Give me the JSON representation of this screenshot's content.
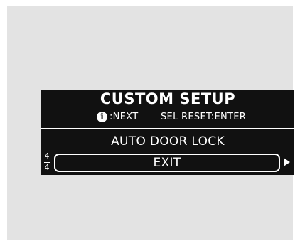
{
  "screen": {
    "title": "CUSTOM SETUP",
    "hint": {
      "icon": "info-icon",
      "icon_glyph": "i",
      "next_label": ":NEXT",
      "select_reset_label": "SEL RESET:ENTER"
    },
    "menu": {
      "previous_item": "AUTO DOOR LOCK",
      "selected_item": "EXIT",
      "page_current": "4",
      "page_total": "4",
      "next_arrow_icon": "arrow-right-icon"
    }
  }
}
